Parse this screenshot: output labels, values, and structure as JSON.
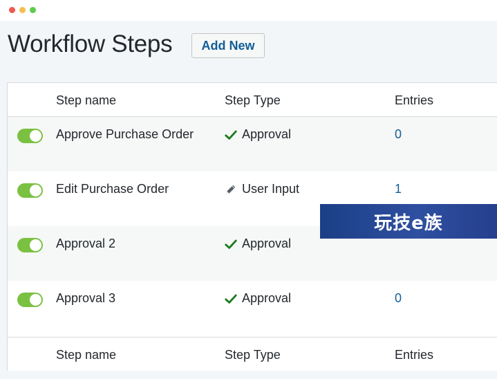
{
  "window": {
    "controls": [
      "close",
      "minimize",
      "zoom"
    ]
  },
  "header": {
    "title": "Workflow Steps",
    "add_new_label": "Add New"
  },
  "table": {
    "columns": {
      "name": "Step name",
      "type": "Step Type",
      "entries": "Entries"
    },
    "rows": [
      {
        "enabled": true,
        "name": "Approve Purchase Order",
        "type": "Approval",
        "type_icon": "check-icon",
        "entries": "0"
      },
      {
        "enabled": true,
        "name": "Edit Purchase Order",
        "type": "User Input",
        "type_icon": "pencil-icon",
        "entries": "1"
      },
      {
        "enabled": true,
        "name": "Approval 2",
        "type": "Approval",
        "type_icon": "check-icon",
        "entries": ""
      },
      {
        "enabled": true,
        "name": "Approval 3",
        "type": "Approval",
        "type_icon": "check-icon",
        "entries": "0"
      }
    ]
  },
  "watermark": {
    "text": "玩技e族"
  },
  "colors": {
    "accent": "#135e96",
    "toggle_on": "#7ac142",
    "check": "#1e7b1e"
  }
}
